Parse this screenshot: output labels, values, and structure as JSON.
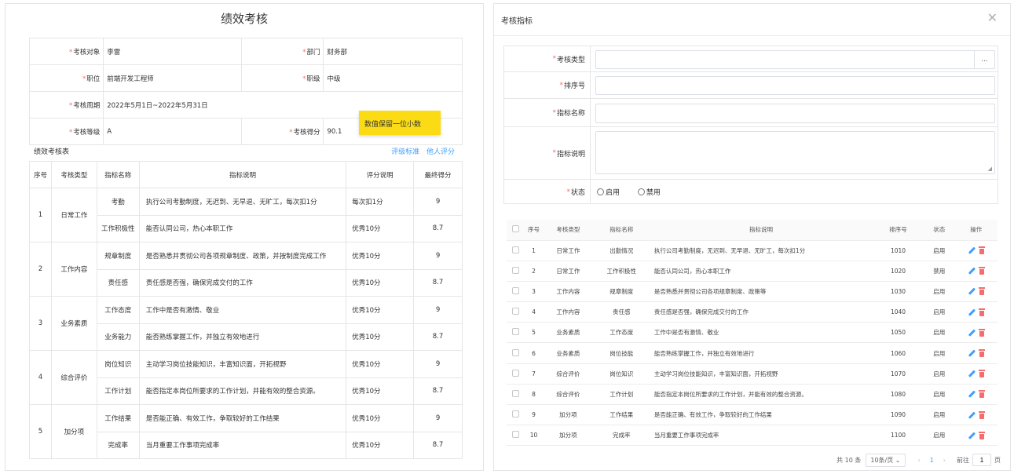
{
  "left": {
    "title": "绩效考核",
    "info": {
      "target_label": "考核对象",
      "target_value": "李雷",
      "dept_label": "部门",
      "dept_value": "财务部",
      "position_label": "职位",
      "position_value": "前端开发工程师",
      "rank_label": "职级",
      "rank_value": "中级",
      "period_label": "考核周期",
      "period_value": "2022年5月1日~2022年5月31日",
      "grade_label": "考核等级",
      "grade_value": "A",
      "score_label": "考核得分",
      "score_value": "90.1"
    },
    "tooltip": "数值保留一位小数",
    "section_label": "绩效考核表",
    "links": {
      "rating_standard": "评级标准",
      "others_score": "他人评分"
    },
    "table": {
      "headers": [
        "序号",
        "考核类型",
        "指标名称",
        "指标说明",
        "评分说明",
        "最终得分"
      ],
      "groups": [
        {
          "no": "1",
          "type": "日常工作",
          "rows": [
            {
              "name": "考勤",
              "desc": "执行公司考勤制度，无迟到、无早退、无旷工，每次扣1分",
              "rule": "每次扣1分",
              "score": "9"
            },
            {
              "name": "工作积极性",
              "desc": "能否认同公司，热心本职工作",
              "rule": "优秀10分",
              "score": "8.7"
            }
          ]
        },
        {
          "no": "2",
          "type": "工作内容",
          "rows": [
            {
              "name": "规章制度",
              "desc": "是否熟悉并贯彻公司各项规章制度、政策，并按制度完成工作",
              "rule": "优秀10分",
              "score": "9"
            },
            {
              "name": "责任感",
              "desc": "责任感是否强，确保完成交付的工作",
              "rule": "优秀10分",
              "score": "8.7"
            }
          ]
        },
        {
          "no": "3",
          "type": "业务素质",
          "rows": [
            {
              "name": "工作态度",
              "desc": "工作中是否有激情、敬业",
              "rule": "优秀10分",
              "score": "9"
            },
            {
              "name": "业务能力",
              "desc": "能否熟练掌握工作，并独立有效地进行",
              "rule": "优秀10分",
              "score": "8.7"
            }
          ]
        },
        {
          "no": "4",
          "type": "综合评价",
          "rows": [
            {
              "name": "岗位知识",
              "desc": "主动学习岗位技能知识，丰富知识面，开拓视野",
              "rule": "优秀10分",
              "score": "9"
            },
            {
              "name": "工作计划",
              "desc": "能否指定本岗位所要求的工作计划，并能有效的整合资源。",
              "rule": "优秀10分",
              "score": "8.7"
            }
          ]
        },
        {
          "no": "5",
          "type": "加分项",
          "rows": [
            {
              "name": "工作结果",
              "desc": "是否能正确、有效工作，争取较好的工作结果",
              "rule": "优秀10分",
              "score": "9"
            },
            {
              "name": "完成率",
              "desc": "当月重要工作事项完成率",
              "rule": "优秀10分",
              "score": "8.7"
            }
          ]
        }
      ]
    }
  },
  "dialog": {
    "title": "考核指标",
    "form": {
      "type_label": "考核类型",
      "type_button": "...",
      "order_label": "排序号",
      "name_label": "指标名称",
      "desc_label": "指标说明",
      "status_label": "状态",
      "status_enabled": "启用",
      "status_disabled": "禁用"
    },
    "list": {
      "headers": [
        "序号",
        "考核类型",
        "指标名称",
        "指标说明",
        "排序号",
        "状态",
        "操作"
      ],
      "rows": [
        {
          "no": "1",
          "type": "日常工作",
          "name": "出勤情况",
          "desc": "执行公司考勤制度，无迟到、无早退、无旷工，每次扣1分",
          "order": "1010",
          "status": "启用"
        },
        {
          "no": "2",
          "type": "日常工作",
          "name": "工作积极性",
          "desc": "能否认同公司，热心本职工作",
          "order": "1020",
          "status": "禁用"
        },
        {
          "no": "3",
          "type": "工作内容",
          "name": "规章制度",
          "desc": "是否熟悉并贯彻公司各项规章制度、政策等",
          "order": "1030",
          "status": "启用"
        },
        {
          "no": "4",
          "type": "工作内容",
          "name": "责任感",
          "desc": "责任感是否强，确保完成交付的工作",
          "order": "1040",
          "status": "启用"
        },
        {
          "no": "5",
          "type": "业务素质",
          "name": "工作态度",
          "desc": "工作中是否有激情、敬业",
          "order": "1050",
          "status": "启用"
        },
        {
          "no": "6",
          "type": "业务素质",
          "name": "岗位技能",
          "desc": "能否熟练掌握工作，并独立有效地进行",
          "order": "1060",
          "status": "启用"
        },
        {
          "no": "7",
          "type": "综合评价",
          "name": "岗位知识",
          "desc": "主动学习岗位技能知识，丰富知识面，开拓视野",
          "order": "1070",
          "status": "启用"
        },
        {
          "no": "8",
          "type": "综合评价",
          "name": "工作计划",
          "desc": "能否指定本岗位所要求的工作计划，并能有效的整合资源。",
          "order": "1080",
          "status": "启用"
        },
        {
          "no": "9",
          "type": "加分项",
          "name": "工作结果",
          "desc": "是否能正确、有效工作，争取较好的工作结果",
          "order": "1090",
          "status": "启用"
        },
        {
          "no": "10",
          "type": "加分项",
          "name": "完成率",
          "desc": "当月重要工作事项完成率",
          "order": "1100",
          "status": "启用"
        }
      ]
    },
    "pagination": {
      "total": "共 10 条",
      "page_size": "10条/页",
      "current": "1",
      "goto_label": "前往",
      "goto_value": "1",
      "page_suffix": "页"
    }
  }
}
